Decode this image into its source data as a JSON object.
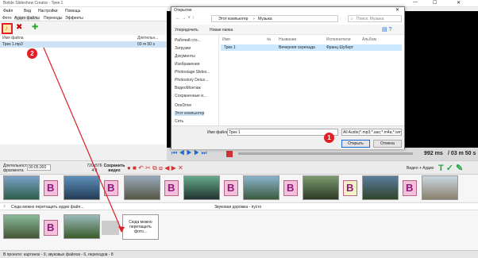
{
  "app": {
    "title": "Bolide Slideshow Creator - Трек 1",
    "menu": [
      "Файл",
      "Вид",
      "Настройки",
      "Помощь"
    ],
    "tabs": [
      "Фото",
      "Аудио файлы",
      "Переходы",
      "Эффекты"
    ],
    "list": {
      "col_name": "Имя файла",
      "col_dur": "Длительн...",
      "row_name": "Трек 1.mp3",
      "row_dur": "03 m 50 s"
    },
    "player": {
      "time": "992 ms",
      "total": "/ 03 m 50 s"
    },
    "midbar": {
      "dur_label": "Длительность фрагмента",
      "dur_value": "00:05,000",
      "ratio": "720х576 4:3",
      "save": "Сохранить видео",
      "video_audio": "Видео + Аудио"
    },
    "audiotrack": {
      "drop": "Сюда можно перетащить аудио файл...",
      "empty": "Звуковая дорожка - пусто"
    },
    "drop_photo": "Сюда можно перетащить фото...",
    "status": "В проекте: картинок - 9, звуковых файлов - 6, переходов - 8"
  },
  "dialog": {
    "title": "Открытие",
    "path": [
      "Этот компьютер",
      "Музыка"
    ],
    "search": "Поиск: Музыка",
    "organize": "Упорядочить",
    "new_folder": "Новая папка",
    "nav": [
      "Рабочий сто...",
      "Загрузки",
      "Документы",
      "Изображения",
      "Photostage Slides...",
      "Photostory Delux...",
      "ВидеоМонтаж",
      "Сохраненные и...",
      "OneDrive",
      "Этот компьютер",
      "Сеть"
    ],
    "columns": [
      "Имя",
      "№",
      "Название",
      "Исполнители",
      "Альбом"
    ],
    "file": {
      "name": "Трек 1",
      "title": "Вечерняя серенада",
      "artist": "Франц Шуберт"
    },
    "filename_label": "Имя файла:",
    "filename_value": "Трек 1",
    "filter": "All Audio(*.mp3;*.aac;*.m4a;*.wma)",
    "open": "Открыть",
    "cancel": "Отмена"
  },
  "badges": {
    "one": "1",
    "two": "2"
  },
  "colors": {
    "accent": "#e01f26",
    "selection": "#cfe3f7",
    "trans": "#f3c1dc"
  }
}
